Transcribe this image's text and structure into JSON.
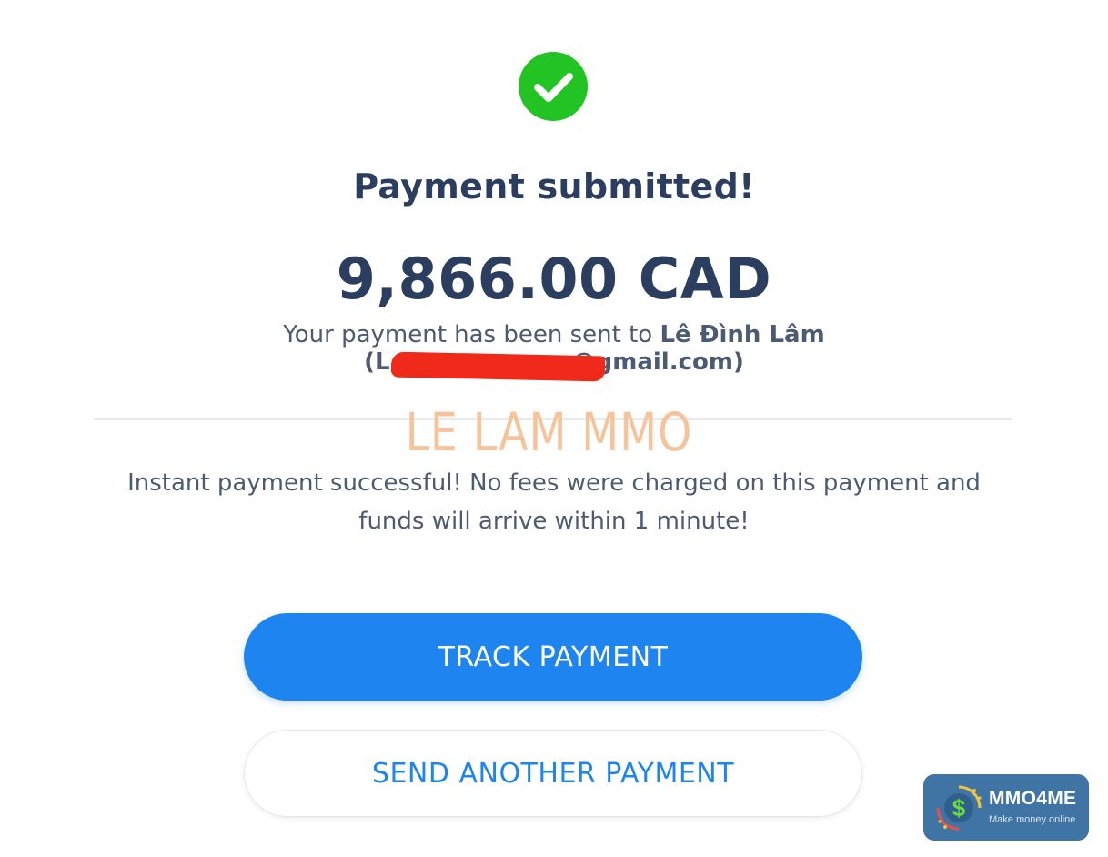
{
  "status": {
    "icon": "check-circle-icon",
    "title": "Payment submitted!"
  },
  "payment": {
    "amount": "9,866.00 CAD",
    "sent_to_prefix": "Your payment has been sent to ",
    "recipient_name": "Lê Đình Lâm",
    "recipient_email_open": "(L",
    "recipient_email_domain": "@gmail.com)"
  },
  "watermark": "LE LAM MMO",
  "info_message": "Instant payment successful! No fees were charged on this payment and funds will arrive within 1 minute!",
  "actions": {
    "track_label": "TRACK PAYMENT",
    "send_another_label": "SEND ANOTHER PAYMENT"
  },
  "logo": {
    "name": "MMO4ME",
    "tagline": "Make money online",
    "symbol": "$"
  },
  "colors": {
    "success_green": "#21c423",
    "primary_blue": "#1e84ef",
    "heading_navy": "#2c3e5f",
    "redaction_red": "#ef2a1a",
    "watermark_orange": "#f6c49a",
    "logo_blue": "#3f74a5"
  }
}
